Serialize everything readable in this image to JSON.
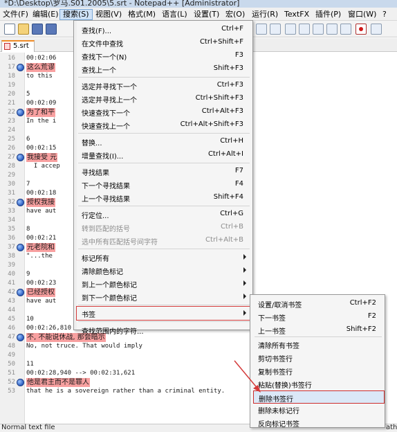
{
  "window": {
    "title": "*D:\\Desktop\\罗马.S01.2005\\5.srt - Notepad++ [Administrator]"
  },
  "menubar": {
    "items": [
      {
        "label": "文件(F)"
      },
      {
        "label": "编辑(E)"
      },
      {
        "label": "搜索(S)",
        "active": true
      },
      {
        "label": "视图(V)"
      },
      {
        "label": "格式(M)"
      },
      {
        "label": "语言(L)"
      },
      {
        "label": "设置(T)"
      },
      {
        "label": "宏(O)"
      },
      {
        "label": "运行(R)"
      },
      {
        "label": "TextFX"
      },
      {
        "label": "插件(P)"
      },
      {
        "label": "窗口(W)"
      },
      {
        "label": "?"
      }
    ]
  },
  "toolbar": {
    "icons": [
      "new-file-icon",
      "open-folder-icon",
      "save-icon",
      "save-all-icon",
      "replace-icon",
      "find-in-files-icon",
      "word-wrap-icon",
      "indent-guide-icon",
      "doc-map-icon",
      "function-list-icon",
      "record-macro-icon",
      "stop-record-icon"
    ]
  },
  "tab": {
    "label": "5.srt"
  },
  "editor": {
    "lines": [
      {
        "num": "16",
        "text": "00:02:06",
        "bookmark": false,
        "highlight": false
      },
      {
        "num": "17",
        "text": "这么荒谬",
        "bookmark": true,
        "highlight": true
      },
      {
        "num": "18",
        "text": "to this",
        "bookmark": false,
        "highlight": false
      },
      {
        "num": "19",
        "text": "",
        "bookmark": false,
        "highlight": false
      },
      {
        "num": "20",
        "text": "5",
        "bookmark": false,
        "highlight": false
      },
      {
        "num": "21",
        "text": "00:02:09",
        "bookmark": false,
        "highlight": false
      },
      {
        "num": "22",
        "text": "为了和平",
        "bookmark": true,
        "highlight": true
      },
      {
        "num": "23",
        "text": "In the i",
        "bookmark": false,
        "highlight": false
      },
      {
        "num": "24",
        "text": "",
        "bookmark": false,
        "highlight": false
      },
      {
        "num": "25",
        "text": "6",
        "bookmark": false,
        "highlight": false
      },
      {
        "num": "26",
        "text": "00:02:15",
        "bookmark": false,
        "highlight": false
      },
      {
        "num": "27",
        "text": "我接受 元",
        "bookmark": true,
        "highlight": true
      },
      {
        "num": "28",
        "text": "  I accep",
        "bookmark": false,
        "highlight": false
      },
      {
        "num": "29",
        "text": "",
        "bookmark": false,
        "highlight": false
      },
      {
        "num": "30",
        "text": "7",
        "bookmark": false,
        "highlight": false
      },
      {
        "num": "31",
        "text": "00:02:18",
        "bookmark": false,
        "highlight": false
      },
      {
        "num": "32",
        "text": "授权我接",
        "bookmark": true,
        "highlight": true
      },
      {
        "num": "33",
        "text": "have aut",
        "bookmark": false,
        "highlight": false
      },
      {
        "num": "34",
        "text": "",
        "bookmark": false,
        "highlight": false
      },
      {
        "num": "35",
        "text": "8",
        "bookmark": false,
        "highlight": false
      },
      {
        "num": "36",
        "text": "00:02:21",
        "bookmark": false,
        "highlight": false
      },
      {
        "num": "37",
        "text": "元老院和",
        "bookmark": true,
        "highlight": true
      },
      {
        "num": "38",
        "text": "\"...the",
        "bookmark": false,
        "highlight": false
      },
      {
        "num": "39",
        "text": "",
        "bookmark": false,
        "highlight": false
      },
      {
        "num": "40",
        "text": "9",
        "bookmark": false,
        "highlight": false
      },
      {
        "num": "41",
        "text": "00:02:23",
        "bookmark": false,
        "highlight": false
      },
      {
        "num": "42",
        "text": "已经授权",
        "bookmark": true,
        "highlight": true
      },
      {
        "num": "43",
        "text": "have aut",
        "bookmark": false,
        "highlight": false
      },
      {
        "num": "44",
        "text": "",
        "bookmark": false,
        "highlight": false
      },
      {
        "num": "45",
        "text": "10",
        "bookmark": false,
        "highlight": false
      },
      {
        "num": "46",
        "text": "00:02:26,810 --> 00:02:28,880",
        "bookmark": false,
        "highlight": false
      },
      {
        "num": "47",
        "text": "不, 不能说休战, 那会暗示",
        "bookmark": true,
        "highlight": true
      },
      {
        "num": "48",
        "text": "No, not truce. That would imply",
        "bookmark": false,
        "highlight": false
      },
      {
        "num": "49",
        "text": "",
        "bookmark": false,
        "highlight": false
      },
      {
        "num": "50",
        "text": "11",
        "bookmark": false,
        "highlight": false
      },
      {
        "num": "51",
        "text": "00:02:28,940 --> 00:02:31,621",
        "bookmark": false,
        "highlight": false
      },
      {
        "num": "52",
        "text": "他是君主而不是罪人",
        "bookmark": true,
        "highlight": true
      },
      {
        "num": "53",
        "text": "that he is a sovereign rather than a criminal entity.",
        "bookmark": false,
        "highlight": false
      }
    ]
  },
  "search_menu": {
    "items": [
      {
        "label": "查找(F)...",
        "shortcut": "Ctrl+F"
      },
      {
        "label": "在文件中查找",
        "shortcut": "Ctrl+Shift+F"
      },
      {
        "label": "查找下一个(N)",
        "shortcut": "F3"
      },
      {
        "label": "查找上一个",
        "shortcut": "Shift+F3"
      },
      {
        "label": "选定并寻找下一个",
        "shortcut": "Ctrl+F3"
      },
      {
        "label": "选定并寻找上一个",
        "shortcut": "Ctrl+Shift+F3"
      },
      {
        "label": "快速查找下一个",
        "shortcut": "Ctrl+Alt+F3"
      },
      {
        "label": "快速查找上一个",
        "shortcut": "Ctrl+Alt+Shift+F3"
      },
      {
        "label": "替换...",
        "shortcut": "Ctrl+H"
      },
      {
        "label": "增量查找(I)...",
        "shortcut": "Ctrl+Alt+I"
      },
      {
        "label": "寻找结果",
        "shortcut": "F7"
      },
      {
        "label": "下一个寻找结果",
        "shortcut": "F4"
      },
      {
        "label": "上一个寻找结果",
        "shortcut": "Shift+F4"
      },
      {
        "label": "行定位...",
        "shortcut": "Ctrl+G"
      },
      {
        "label": "转到匹配的括号",
        "shortcut": "Ctrl+B",
        "disabled": true
      },
      {
        "label": "选中所有匹配括号间字符",
        "shortcut": "Ctrl+Alt+B",
        "disabled": true
      },
      {
        "label": "标记所有",
        "submenu": true
      },
      {
        "label": "清除颜色标记",
        "submenu": true
      },
      {
        "label": "到上一个颜色标记",
        "submenu": true
      },
      {
        "label": "到下一个颜色标记",
        "submenu": true
      },
      {
        "label": "书签",
        "submenu": true
      },
      {
        "label": "查找范围内的字符..."
      }
    ]
  },
  "bookmark_menu": {
    "items": [
      {
        "label": "设置/取消书签",
        "shortcut": "Ctrl+F2"
      },
      {
        "label": "下一书签",
        "shortcut": "F2"
      },
      {
        "label": "上一书签",
        "shortcut": "Shift+F2"
      },
      {
        "label": "清除所有书签"
      },
      {
        "label": "剪切书签行"
      },
      {
        "label": "复制书签行"
      },
      {
        "label": "粘贴(替换)书签行"
      },
      {
        "label": "删除书签行",
        "selected": true
      },
      {
        "label": "删除未标记行"
      },
      {
        "label": "反向标记书签"
      }
    ]
  },
  "statusbar": {
    "left": "Normal text file",
    "right": "ath"
  },
  "colors": {
    "highlight": "#f8a0a0",
    "annotation": "#d43a3a",
    "bookmark": "#2b5dbf"
  }
}
